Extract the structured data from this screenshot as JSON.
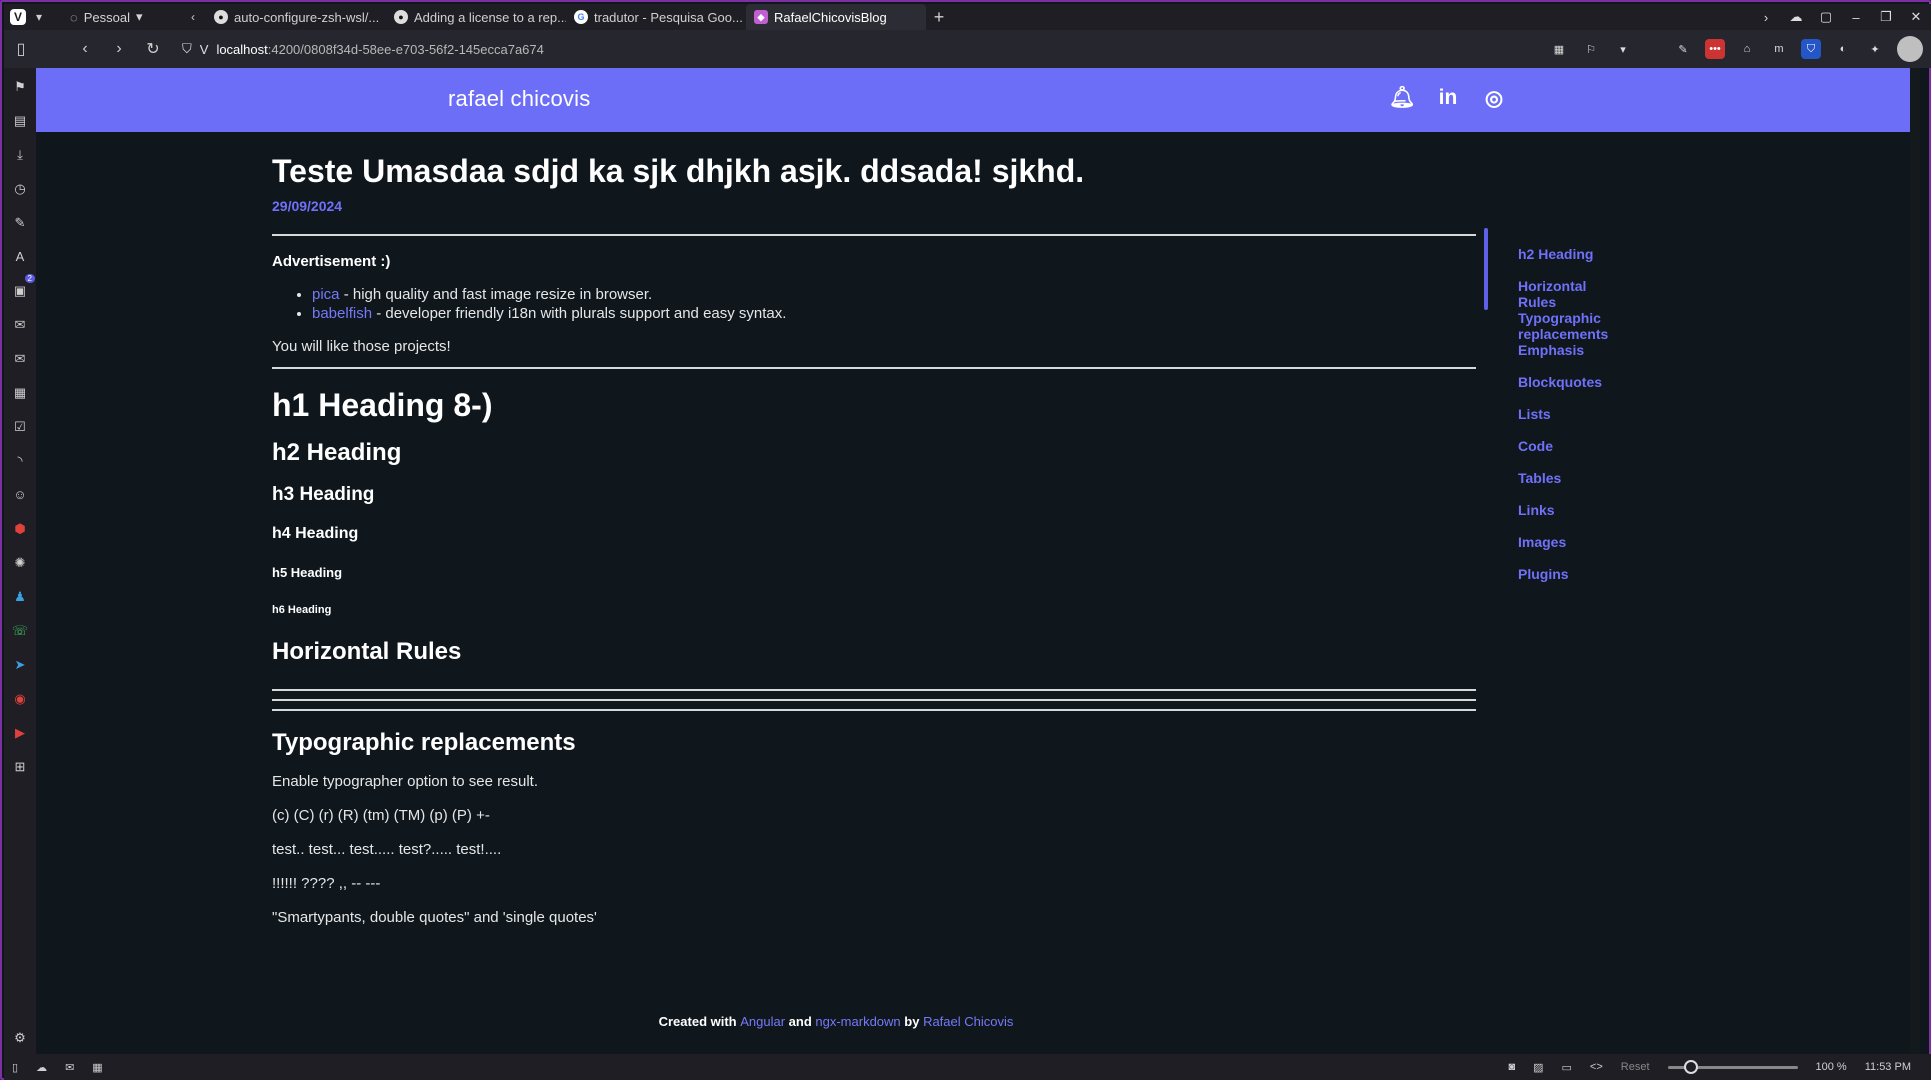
{
  "browser": {
    "workspace_label": "Pessoal",
    "tabs": [
      {
        "label": "auto-configure-zsh-wsl/...",
        "icon": "github-icon"
      },
      {
        "label": "Adding a license to a rep...",
        "icon": "github-icon"
      },
      {
        "label": "tradutor - Pesquisa Goo...",
        "icon": "google-icon"
      },
      {
        "label": "RafaelChicovisBlog",
        "icon": "blog-icon",
        "active": true
      }
    ],
    "url_host": "localhost",
    "url_path": ":4200/0808f34d-58ee-e703-56f2-145ecca7a674",
    "side_panel_badge": "2",
    "status": {
      "reset_label": "Reset",
      "zoom": "100 %",
      "zoom_level": 1.0,
      "time": "11:53 PM"
    }
  },
  "site": {
    "brand": "rafael chicovis",
    "accent": "#6c6ef7",
    "header_icons": [
      "bell-icon",
      "linkedin-icon",
      "github-icon"
    ],
    "linkedin_glyph": "in"
  },
  "post": {
    "title": "Teste Umasdaa sdjd ka sjk dhjkh asjk. ddsada! sjkhd.",
    "date": "29/09/2024",
    "ad_title": "Advertisement :)",
    "ad_items": [
      {
        "link": "pica",
        "text": " - high quality and fast image resize in browser."
      },
      {
        "link": "babelfish",
        "text": " - developer friendly i18n with plurals support and easy syntax."
      }
    ],
    "like_text": "You will like those projects!",
    "h1": "h1 Heading 8-)",
    "h2": "h2 Heading",
    "h3": "h3 Heading",
    "h4": "h4 Heading",
    "h5": "h5 Heading",
    "h6": "h6 Heading",
    "hr_title": "Horizontal Rules",
    "typo_title": "Typographic replacements",
    "typo_lines": [
      "Enable typographer option to see result.",
      "(c) (C) (r) (R) (tm) (TM) (p) (P) +-",
      "test.. test... test..... test?..... test!....",
      "!!!!!! ???? ,, -- ---",
      "\"Smartypants, double quotes\" and 'single quotes'"
    ]
  },
  "toc": {
    "items": [
      "h2 Heading",
      "Horizontal Rules",
      "Typographic replacements",
      "Emphasis",
      "Blockquotes",
      "Lists",
      "Code",
      "Tables",
      "Links",
      "Images",
      "Plugins"
    ]
  },
  "footer": {
    "created_with": "Created with ",
    "angular": "Angular",
    "and": " and ",
    "ngx": "ngx-markdown",
    "by": " by ",
    "author": "Rafael Chicovis"
  }
}
